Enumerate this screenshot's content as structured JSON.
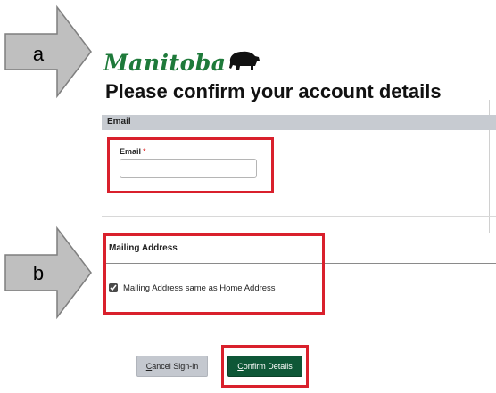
{
  "callouts": {
    "a": "a",
    "b": "b"
  },
  "logo": {
    "wordmark": "Manitoba",
    "emblem": "bison-icon"
  },
  "page_title": "Please confirm your account details",
  "email_section": {
    "header": "Email",
    "field_label": "Email",
    "required_marker": "*",
    "value": "",
    "placeholder": ""
  },
  "mailing_section": {
    "header": "Mailing Address",
    "checkbox_label": "Mailing Address same as Home Address",
    "checkbox_checked": true
  },
  "actions": {
    "cancel_label_underlined": "C",
    "cancel_label_rest": "ancel Sign-in",
    "confirm_label_underlined": "C",
    "confirm_label_rest": "onfirm Details"
  },
  "colors": {
    "highlight": "#d9202c",
    "confirm_button": "#0e5737",
    "cancel_button": "#c4c8cf",
    "logo_green": "#1e7a3a",
    "callout_fill": "#bfbfbf"
  }
}
